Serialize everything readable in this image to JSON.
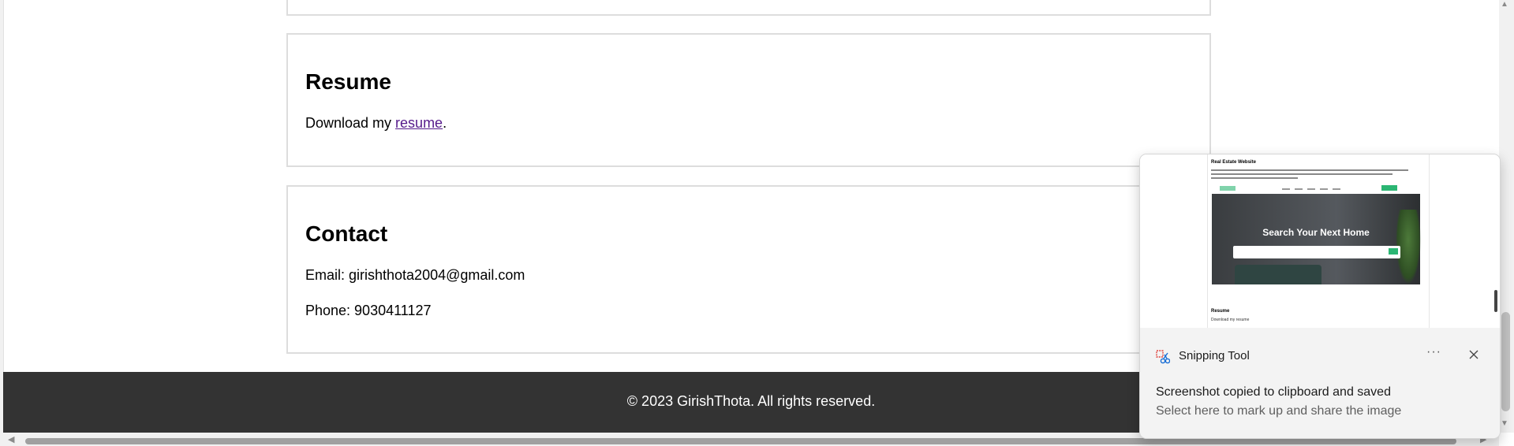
{
  "page": {
    "resume": {
      "heading": "Resume",
      "text_before": "Download my ",
      "link": "resume",
      "text_after": "."
    },
    "contact": {
      "heading": "Contact",
      "email": "Email: girishthota2004@gmail.com",
      "phone": "Phone: 9030411127"
    },
    "footer": {
      "text": "© 2023 GirishThota. All rights reserved."
    }
  },
  "toast": {
    "app_name": "Snipping Tool",
    "more_label": "···",
    "message": "Screenshot copied to clipboard and saved",
    "sub_message": "Select here to mark up and share the image",
    "preview": {
      "title": "Real Estate Website",
      "hero_text": "Search Your Next Home",
      "resume_heading": "Resume",
      "resume_text": "Download my resume"
    }
  },
  "colors": {
    "footer_bg": "#333333",
    "link_visited": "#551a8b",
    "accent_green": "#2bb673"
  }
}
